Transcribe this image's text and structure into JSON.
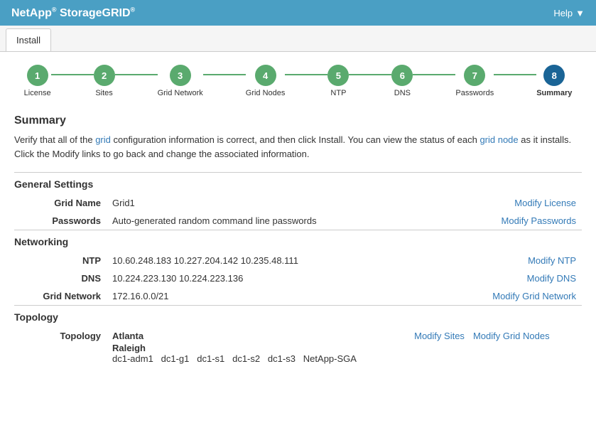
{
  "header": {
    "title": "NetApp",
    "titleSup1": "®",
    "titleMain": " StorageGRID",
    "titleSup2": "®",
    "helpLabel": "Help"
  },
  "tabs": [
    {
      "label": "Install",
      "active": true
    }
  ],
  "stepper": {
    "steps": [
      {
        "number": "1",
        "label": "License",
        "active": false
      },
      {
        "number": "2",
        "label": "Sites",
        "active": false
      },
      {
        "number": "3",
        "label": "Grid Network",
        "active": false
      },
      {
        "number": "4",
        "label": "Grid Nodes",
        "active": false
      },
      {
        "number": "5",
        "label": "NTP",
        "active": false
      },
      {
        "number": "6",
        "label": "DNS",
        "active": false
      },
      {
        "number": "7",
        "label": "Passwords",
        "active": false
      },
      {
        "number": "8",
        "label": "Summary",
        "active": true
      }
    ]
  },
  "summary": {
    "title": "Summary",
    "intro": "Verify that all of the grid configuration information is correct, and then click Install. You can view the status of each grid node as it installs. Click the Modify links to go back and change the associated information.",
    "introLinks": {
      "grid": "grid",
      "grid_node": "grid node"
    }
  },
  "generalSettings": {
    "sectionTitle": "General Settings",
    "rows": [
      {
        "label": "Grid Name",
        "value": "Grid1",
        "actionLabel": "Modify License",
        "actionKey": "modify-license"
      },
      {
        "label": "Passwords",
        "value": "Auto-generated random command line passwords",
        "actionLabel": "Modify Passwords",
        "actionKey": "modify-passwords"
      }
    ]
  },
  "networking": {
    "sectionTitle": "Networking",
    "rows": [
      {
        "label": "NTP",
        "value": "10.60.248.183   10.227.204.142   10.235.48.111",
        "actionLabel": "Modify NTP",
        "actionKey": "modify-ntp"
      },
      {
        "label": "DNS",
        "value": "10.224.223.130   10.224.223.136",
        "actionLabel": "Modify DNS",
        "actionKey": "modify-dns"
      },
      {
        "label": "Grid Network",
        "value": "172.16.0.0/21",
        "actionLabel": "Modify Grid Network",
        "actionKey": "modify-grid-network"
      }
    ]
  },
  "topology": {
    "sectionTitle": "Topology",
    "actionLabel1": "Modify Sites",
    "actionLabel2": "Modify Grid Nodes",
    "sites": [
      {
        "name": "Atlanta",
        "nodes": []
      },
      {
        "name": "Raleigh",
        "nodes": [
          "dc1-adm1",
          "dc1-g1",
          "dc1-s1",
          "dc1-s2",
          "dc1-s3",
          "NetApp-SGA"
        ]
      }
    ]
  }
}
